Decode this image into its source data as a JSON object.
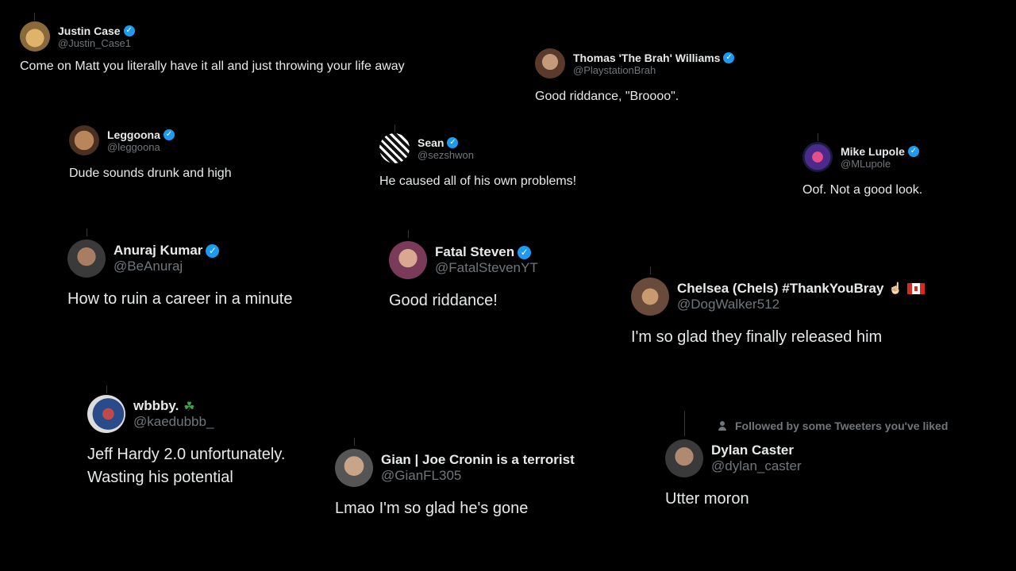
{
  "tweets": [
    {
      "name": "Justin Case",
      "handle": "@Justin_Case1",
      "text": "Come on Matt you literally have it all and just throwing your life away"
    },
    {
      "name": "Thomas 'The Brah' Williams",
      "handle": "@PlaystationBrah",
      "text": "Good riddance, \"Broooo\"."
    },
    {
      "name": "Leggoona",
      "handle": "@leggoona",
      "text": "Dude sounds drunk and high"
    },
    {
      "name": "Sean",
      "handle": "@sezshwon",
      "text": "He caused all of his own problems!"
    },
    {
      "name": "Mike Lupole",
      "handle": "@MLupole",
      "text": "Oof. Not a good look."
    },
    {
      "name": "Anuraj Kumar",
      "handle": "@BeAnuraj",
      "text": "How to ruin a career in a minute"
    },
    {
      "name": "Fatal Steven",
      "handle": "@FatalStevenYT",
      "text": "Good riddance!"
    },
    {
      "name": "Chelsea (Chels) #ThankYouBray",
      "handle": "@DogWalker512",
      "text": "I'm so glad they finally released him",
      "emoji": "☝🏻"
    },
    {
      "name": "wbbby.",
      "handle": "@kaedubbb_",
      "text_line1": "Jeff Hardy 2.0 unfortunately.",
      "text_line2": "Wasting his potential",
      "emoji": "☘"
    },
    {
      "name": "Gian | Joe Cronin is a terrorist",
      "handle": "@GianFL305",
      "text": "Lmao I'm so glad he's gone"
    },
    {
      "name": "Dylan Caster",
      "handle": "@dylan_caster",
      "text": "Utter moron",
      "followed": "Followed by some Tweeters you've liked"
    }
  ],
  "colors": {
    "background": "#000000",
    "text": "#e7e9ea",
    "muted": "#71767b",
    "verified": "#1d9bf0"
  },
  "icons": {
    "verified": "verified-badge-icon",
    "followed": "person-icon",
    "flag": "canada-flag-icon"
  }
}
